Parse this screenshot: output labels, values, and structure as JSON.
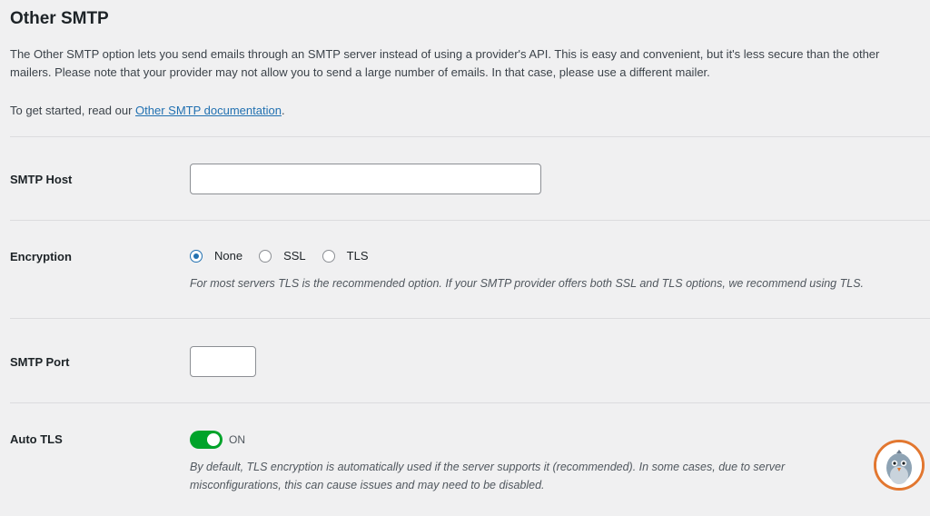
{
  "section": {
    "title": "Other SMTP",
    "description": "The Other SMTP option lets you send emails through an SMTP server instead of using a provider's API. This is easy and convenient, but it's less secure than the other mailers. Please note that your provider may not allow you to send a large number of emails. In that case, please use a different mailer.",
    "get_started_prefix": "To get started, read our ",
    "doc_link": "Other SMTP documentation",
    "get_started_suffix": "."
  },
  "smtp_host": {
    "label": "SMTP Host",
    "value": ""
  },
  "encryption": {
    "label": "Encryption",
    "options": [
      "None",
      "SSL",
      "TLS"
    ],
    "selected": "None",
    "hint": "For most servers TLS is the recommended option. If your SMTP provider offers both SSL and TLS options, we recommend using TLS."
  },
  "smtp_port": {
    "label": "SMTP Port",
    "value": ""
  },
  "auto_tls": {
    "label": "Auto TLS",
    "state": "ON",
    "hint": "By default, TLS encryption is automatically used if the server supports it (recommended). In some cases, due to server misconfigurations, this can cause issues and may need to be disabled."
  },
  "colors": {
    "accent": "#2271b1",
    "toggle_on": "#00a32a",
    "mascot_ring": "#e27730"
  },
  "icons": {
    "help_widget": "pigeon-mascot-icon"
  }
}
